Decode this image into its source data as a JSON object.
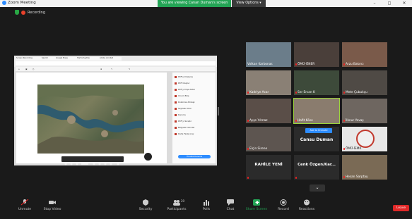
{
  "window": {
    "title": "Zoom Meeting"
  },
  "banner": {
    "viewing": "You are viewing Canan Duman's screen",
    "view_options": "View Options"
  },
  "recording": {
    "label": "Recording"
  },
  "shared_screen": {
    "browser_tabs": [
      "Screen Recording",
      "Search",
      "Google Maps",
      "Harita Sayfası",
      "Adobe Acrobat"
    ],
    "url": "",
    "panel_items": [
      "PDF'yi Düzenle",
      "PDF Oluştur",
      "PDF'yi Dışa Aktar",
      "Yorum Ekle",
      "Doküman Birleşt.",
      "Sayfaları Düz.",
      "Koruma",
      "PDF'yi Sıkıştır",
      "Belgeleri Gönder",
      "Daha Fazla Araç"
    ],
    "panel_button": "Ücretsiz Deneme"
  },
  "participants": [
    {
      "name": "Volkan Karbonas",
      "muted": false
    },
    {
      "name": "ÖMÜ-ÖNER",
      "muted": true
    },
    {
      "name": "Arzu Bakırcı",
      "muted": true
    },
    {
      "name": "Kadriye Acar",
      "muted": true
    },
    {
      "name": "Ser Ercan K",
      "muted": true
    },
    {
      "name": "Mete Çubukçu",
      "muted": true
    },
    {
      "name": "Ayşe Yılmaz",
      "muted": true
    },
    {
      "name": "Hafit Köse",
      "muted": true
    },
    {
      "name": "İlknur Yavaş",
      "muted": true
    },
    {
      "name": "Elçin Sirene",
      "muted": true
    },
    {
      "name": "Cansu Duman",
      "muted": false,
      "ask_button": "Ask to Unmute"
    },
    {
      "name": "ÖMÜ-İEMK",
      "muted": true
    },
    {
      "name": "RAHİLE YENİ",
      "muted": true
    },
    {
      "name": "Cenk Özgen/Kar...",
      "muted": true
    },
    {
      "name": "Hesan Sarptay",
      "muted": true
    }
  ],
  "page_down": "⌄",
  "controls": {
    "unmute": "Unmute",
    "stop_video": "Stop Video",
    "security": "Security",
    "participants": "Participants",
    "participants_count": "20",
    "polls": "Polls",
    "chat": "Chat",
    "share_screen": "Share Screen",
    "record": "Record",
    "reactions": "Reactions",
    "leave": "Leave"
  },
  "colors": {
    "accent_green": "#23a455",
    "leave_red": "#e02828",
    "zoom_blue": "#2d8cff"
  }
}
